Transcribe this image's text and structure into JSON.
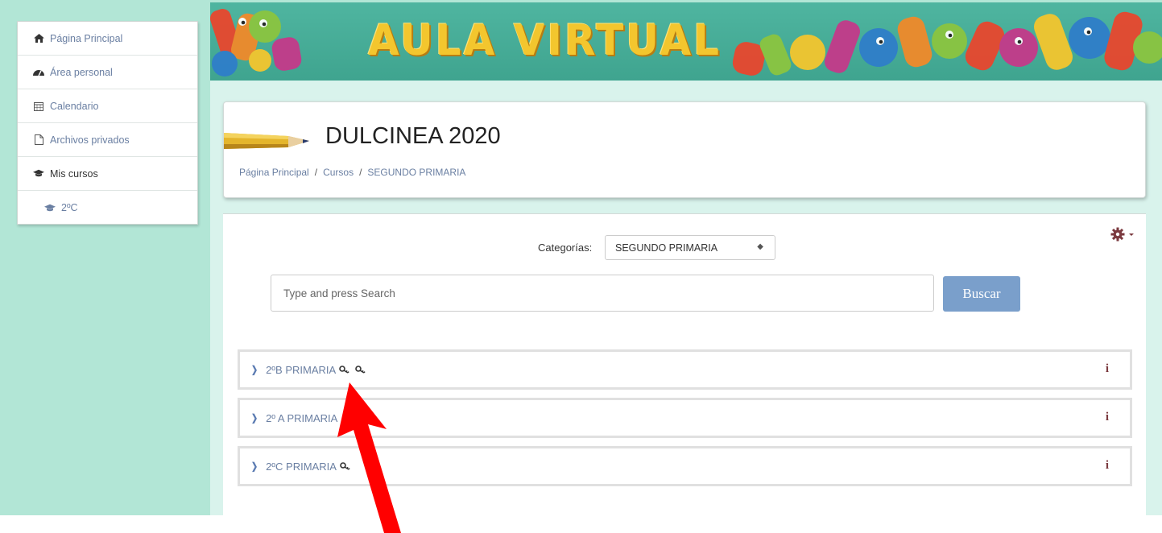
{
  "banner": {
    "title": "AULA VIRTUAL"
  },
  "sidebar": {
    "items": [
      {
        "label": "Página Principal",
        "icon": "home-icon"
      },
      {
        "label": "Área personal",
        "icon": "dashboard-icon"
      },
      {
        "label": "Calendario",
        "icon": "calendar-icon"
      },
      {
        "label": "Archivos privados",
        "icon": "file-icon"
      },
      {
        "label": "Mis cursos",
        "icon": "graduation-cap-icon"
      },
      {
        "label": "2ºC",
        "icon": "graduation-cap-icon"
      }
    ]
  },
  "header": {
    "title": "DULCINEA 2020",
    "breadcrumb": [
      "Página Principal",
      "Cursos",
      "SEGUNDO PRIMARIA"
    ],
    "separator": "/"
  },
  "main": {
    "category_label": "Categorías:",
    "category_selected": "SEGUNDO PRIMARIA",
    "search_placeholder": "Type and press Search",
    "search_button": "Buscar",
    "courses": [
      {
        "name": "2ºB PRIMARIA",
        "keys": 2
      },
      {
        "name": "2º A PRIMARIA",
        "keys": 0
      },
      {
        "name": "2ºC PRIMARIA",
        "keys": 1
      }
    ],
    "info_symbol": "i"
  },
  "colors": {
    "mint": "#b2e6d6",
    "banner": "#3fa48f",
    "link": "#6a7fa2",
    "button": "#7a9fcb",
    "info": "#7b3a3f",
    "arrow": "#ff0000"
  }
}
